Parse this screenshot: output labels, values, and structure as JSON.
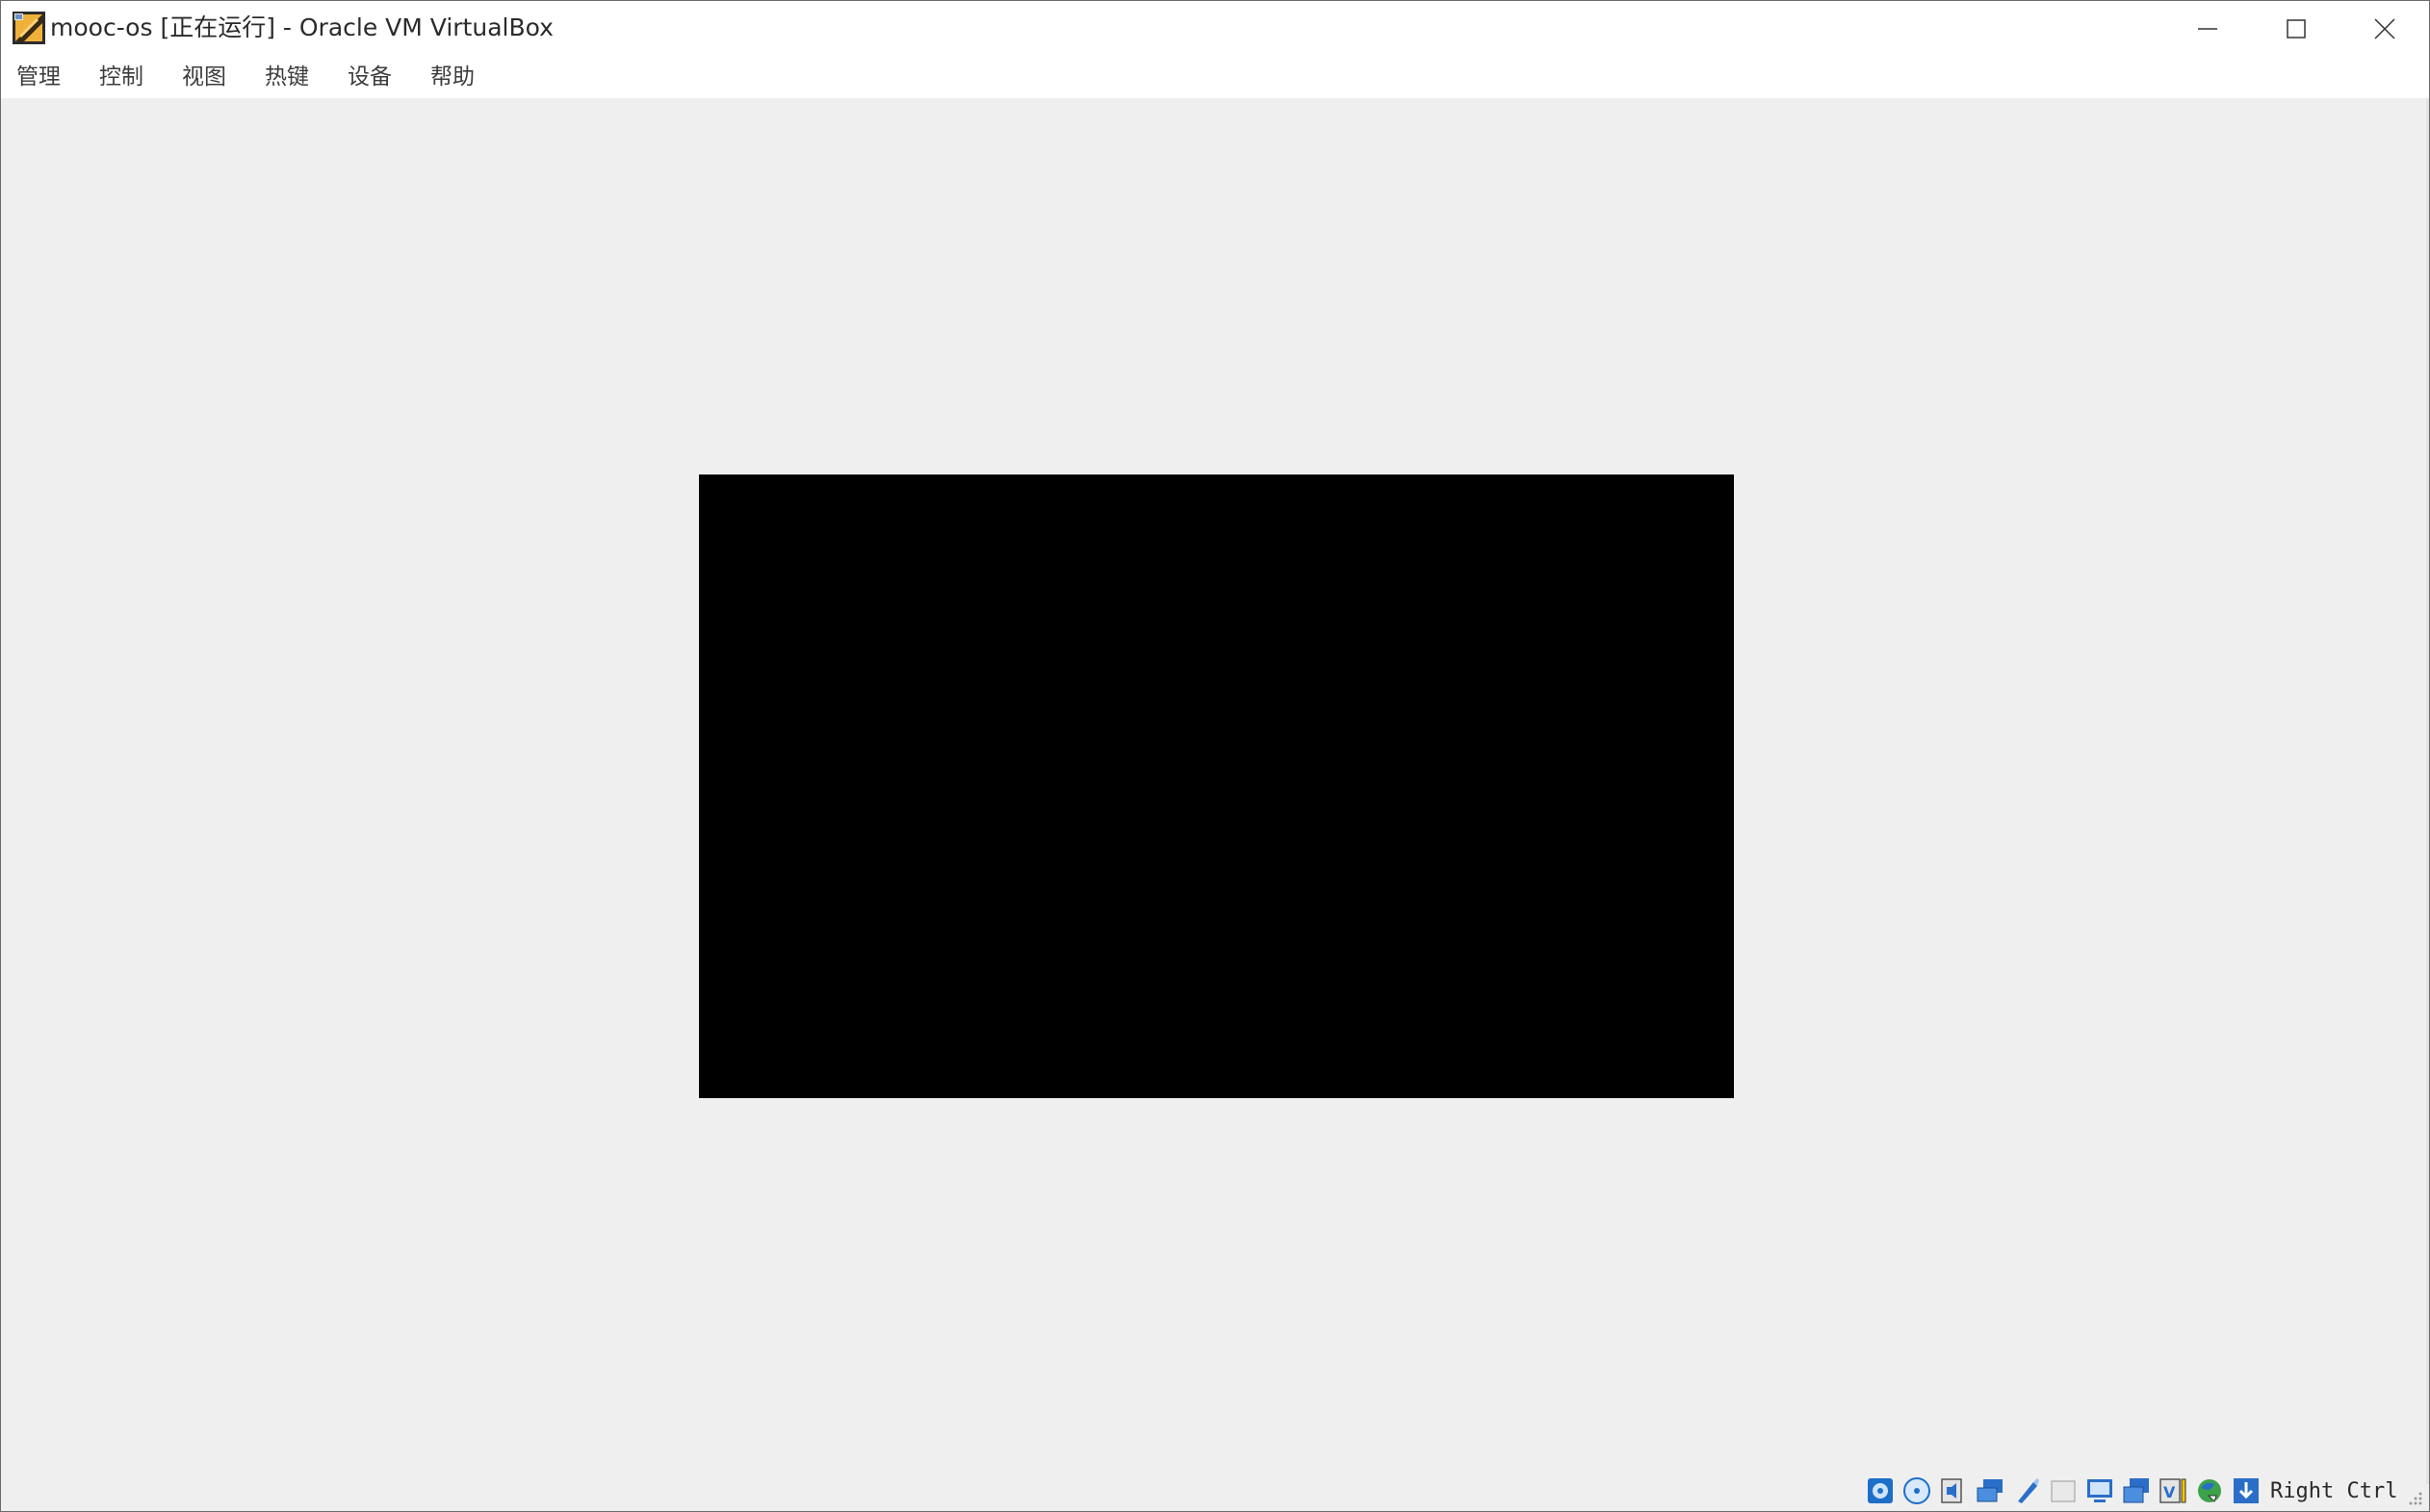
{
  "window": {
    "title": "mooc-os [正在运行] - Oracle VM VirtualBox",
    "icon": "virtualbox-icon"
  },
  "window_controls": {
    "minimize_icon": "minimize-icon",
    "maximize_icon": "maximize-icon",
    "close_icon": "close-icon"
  },
  "menu": {
    "items": [
      {
        "label": "管理"
      },
      {
        "label": "控制"
      },
      {
        "label": "视图"
      },
      {
        "label": "热键"
      },
      {
        "label": "设备"
      },
      {
        "label": "帮助"
      }
    ]
  },
  "guest_display": {
    "background": "#000000"
  },
  "statusbar": {
    "icons": [
      "hard-disk-icon",
      "optical-drive-icon",
      "audio-icon",
      "network-icon",
      "usb-icon",
      "shared-folders-icon",
      "display-icon",
      "video-capture-icon",
      "virtualization-icon",
      "mouse-integration-icon",
      "keyboard-capture-icon"
    ],
    "host_key": "Right Ctrl"
  },
  "colors": {
    "window_bg": "#efefef",
    "titlebar_bg": "#ffffff",
    "accent_blue": "#1c6fc9"
  }
}
